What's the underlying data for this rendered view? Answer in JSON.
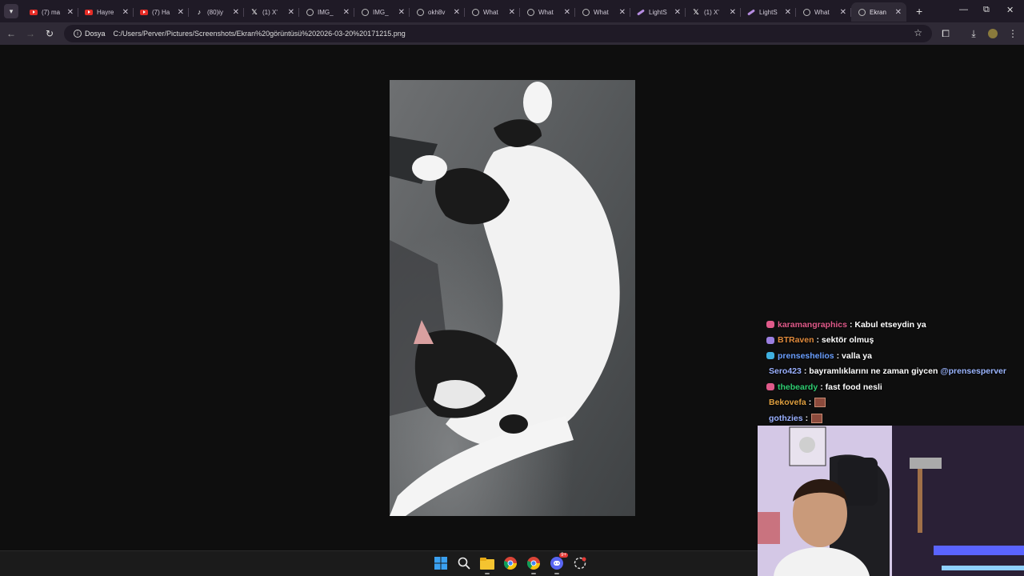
{
  "browser": {
    "tabs": [
      {
        "title": "(7) ma",
        "icon": "youtube-icon"
      },
      {
        "title": "Hayre",
        "icon": "youtube-icon"
      },
      {
        "title": "(7) Ha",
        "icon": "youtube-icon"
      },
      {
        "title": "(80)iy",
        "icon": "tiktok-icon"
      },
      {
        "title": "(1) X'",
        "icon": "x-icon"
      },
      {
        "title": "IMG_",
        "icon": "globe-icon"
      },
      {
        "title": "IMG_",
        "icon": "globe-icon"
      },
      {
        "title": "okh8v",
        "icon": "globe-icon"
      },
      {
        "title": "What",
        "icon": "globe-icon"
      },
      {
        "title": "What",
        "icon": "globe-icon"
      },
      {
        "title": "What",
        "icon": "globe-icon"
      },
      {
        "title": "LightS",
        "icon": "lightshot-icon"
      },
      {
        "title": "(1) X'",
        "icon": "x-icon"
      },
      {
        "title": "LightS",
        "icon": "lightshot-icon"
      },
      {
        "title": "What",
        "icon": "globe-icon"
      },
      {
        "title": "Ekran",
        "icon": "globe-icon",
        "active": true
      }
    ],
    "chip_label": "Dosya",
    "url": "C:/Users/Perver/Pictures/Screenshots/Ekran%20görüntüsü%202026-03-20%20171215.png"
  },
  "chat": {
    "messages": [
      {
        "user": "karamangraphics",
        "color": "#e05a8a",
        "text": ": Kabul etseydin ya",
        "badge": "#e05a8a"
      },
      {
        "user": "BTRaven",
        "color": "#e08a3c",
        "text": ": sektör olmuş",
        "badge": "#9b7fe0"
      },
      {
        "user": "prenseshelios",
        "color": "#6a9fff",
        "text": ": valla ya",
        "badge": "#3fb0e0"
      },
      {
        "user": "Sero423",
        "color": "#9ab0ff",
        "text": ": bayramlıklarını ne zaman giycen",
        "mention": "@prensesperver"
      },
      {
        "user": "thebeardy",
        "color": "#2ecc71",
        "text": ": fast food nesli",
        "badge": "#e05a8a"
      },
      {
        "user": "Bekovefa",
        "color": "#e0a040",
        "text": ":",
        "emote": true
      },
      {
        "user": "gothzies",
        "color": "#9ab0ff",
        "text": ":",
        "emote": true
      }
    ]
  },
  "taskbar": {
    "items": [
      "windows-start-icon",
      "search-icon",
      "file-explorer-icon",
      "chrome-icon",
      "chrome-icon",
      "discord-icon",
      "app-icon"
    ],
    "discord_badge": "9+"
  }
}
